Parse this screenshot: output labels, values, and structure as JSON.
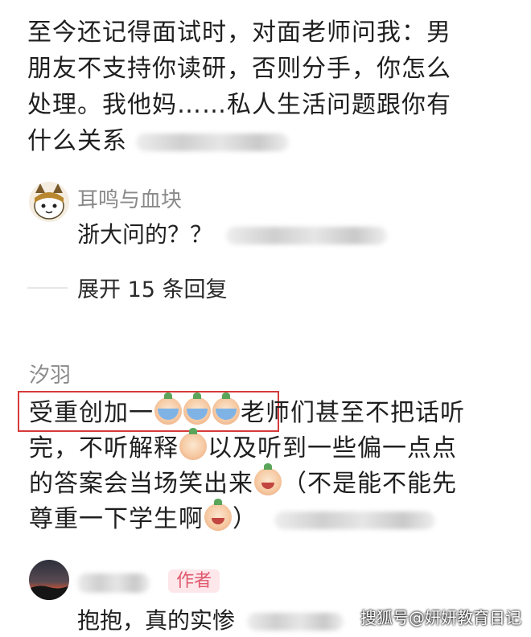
{
  "post": {
    "line1": "至今还记得面试时，对面老师问我：男",
    "line2": "朋友不支持你读研，否则分手，你怎么",
    "line3": "处理。我他妈……私人生活问题跟你有",
    "line4": "什么关系"
  },
  "reply1": {
    "username": "耳鸣与血块",
    "text": "浙大问的？？"
  },
  "expand_label": "展开 15 条回复",
  "comment2": {
    "username": "汐羽",
    "seg1": "受重创加一",
    "seg2": "老师们甚至不把话听",
    "seg3": "完，不听解释",
    "seg4": "以及听到一些偏一点点",
    "seg5": "的答案会当场笑出来",
    "seg6": "（不是能不能先",
    "seg7": "尊重一下学生啊",
    "seg8": "）"
  },
  "reply2": {
    "author_badge": "作者",
    "text": "抱抱，真的实惨"
  },
  "watermark": "搜狐号@妍妍教育日记",
  "colors": {
    "highlight": "#d63a3a",
    "username": "#8a8a8a",
    "author_badge": "#e0586e"
  }
}
